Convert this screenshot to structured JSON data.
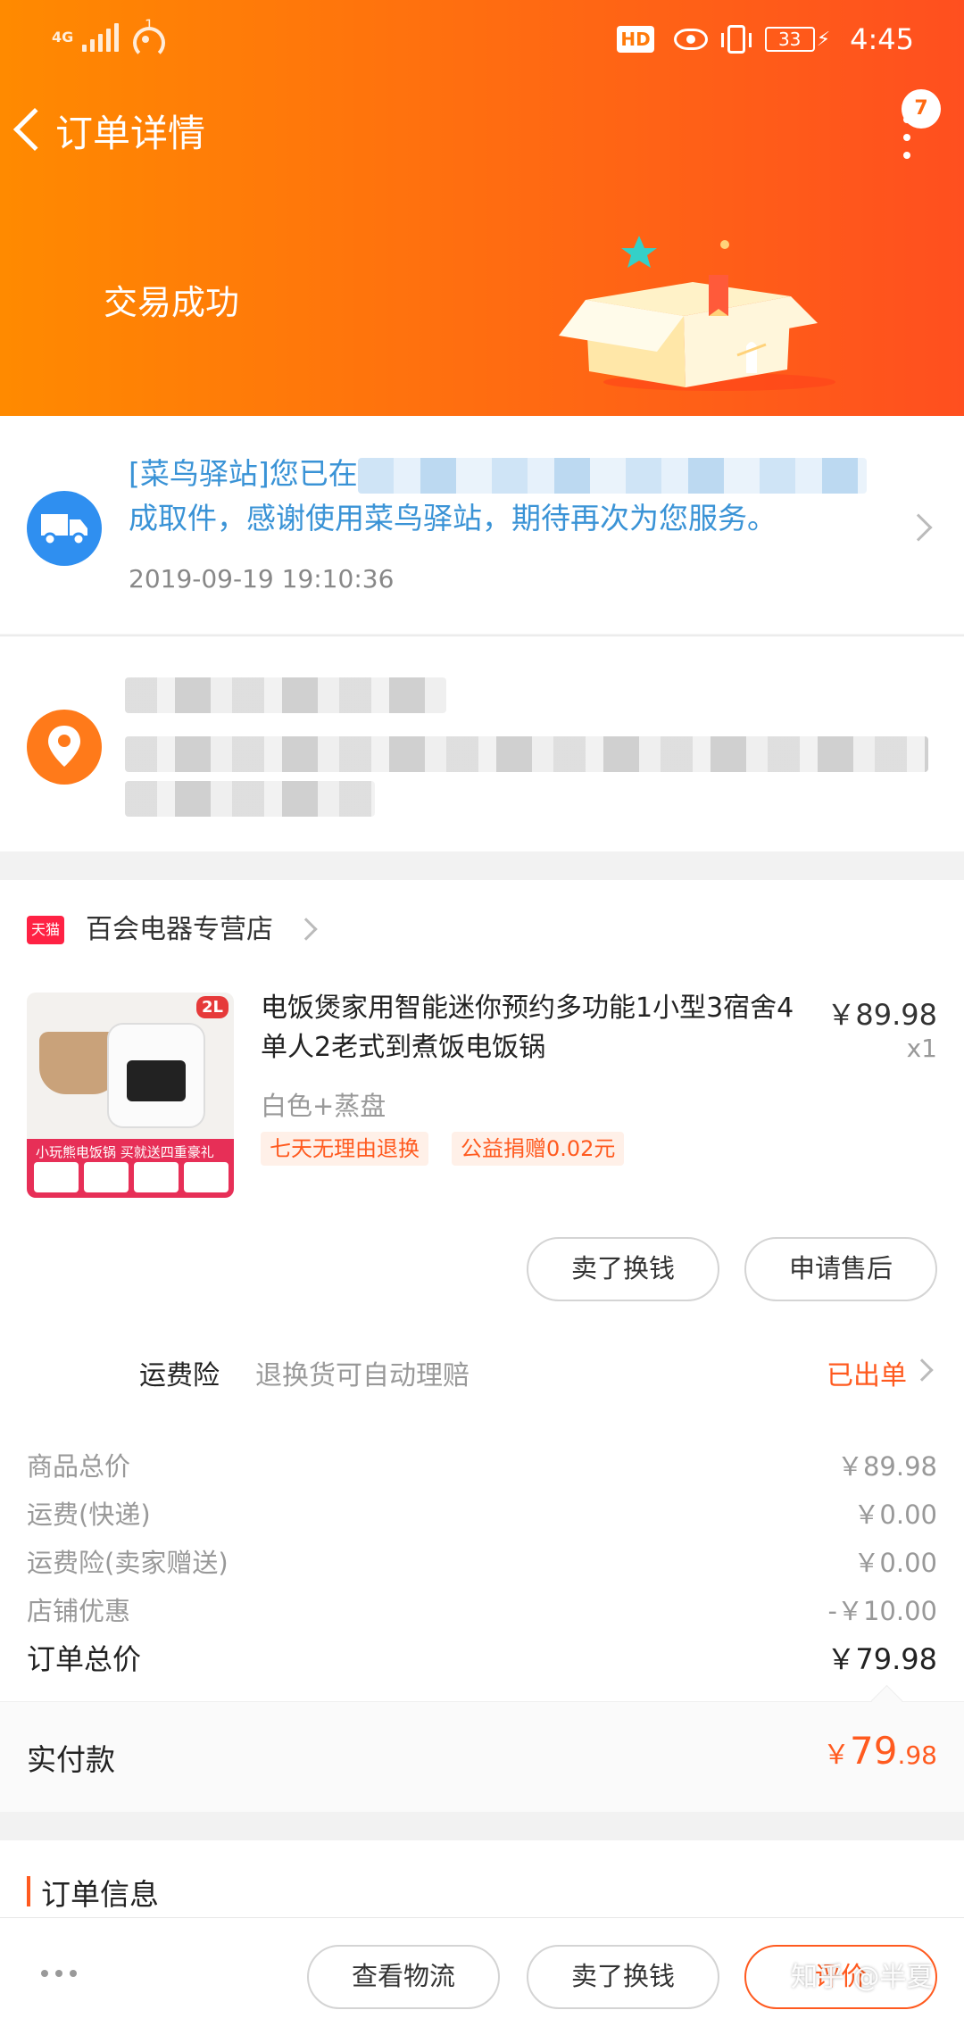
{
  "status_bar": {
    "network": "4G",
    "hotspot_count": "1",
    "hd_label": "HD",
    "battery": "33",
    "time": "4:45"
  },
  "nav": {
    "title": "订单详情",
    "message_badge": "7"
  },
  "order_status": "交易成功",
  "logistics": {
    "message_prefix": "[菜鸟驿站]您已在",
    "message_suffix": "成取件，感谢使用菜鸟驿站，期待再次为您服务。",
    "time": "2019-09-19 19:10:36"
  },
  "shop": {
    "badge": "天猫",
    "name": "百会电器专营店"
  },
  "product": {
    "image_badge": "2L",
    "image_banner": "小玩熊电饭锅 买就送四重豪礼",
    "title": "电饭煲家用智能迷你预约多功能1小型3宿舍4单人2老式到煮饭电饭锅",
    "price": "￥89.98",
    "quantity": "x1",
    "sku": "白色+蒸盘",
    "tags": [
      "七天无理由退换",
      "公益捐赠0.02元"
    ]
  },
  "actions": {
    "sell": "卖了换钱",
    "after_sale": "申请售后"
  },
  "insurance": {
    "label": "运费险",
    "desc": "退换货可自动理赔",
    "status": "已出单"
  },
  "fees": [
    {
      "label": "商品总价",
      "value": "￥89.98"
    },
    {
      "label": "运费(快递)",
      "value": "￥0.00"
    },
    {
      "label": "运费险(卖家赠送)",
      "value": "￥0.00"
    },
    {
      "label": "店铺优惠",
      "value": "-￥10.00"
    }
  ],
  "total": {
    "label": "订单总价",
    "value": "￥79.98"
  },
  "paid": {
    "label": "实付款",
    "currency": "￥",
    "integer": "79",
    "decimal": ".98"
  },
  "order_info": {
    "title": "订单信息"
  },
  "bottom_bar": {
    "logistics": "查看物流",
    "sell": "卖了换钱",
    "evaluate": "评价"
  },
  "watermark": "知乎 @半夏",
  "colors": {
    "accent": "#ff5a1f",
    "header_start": "#ff8a00",
    "header_end": "#ff4f1f",
    "link": "#3a93d6"
  }
}
